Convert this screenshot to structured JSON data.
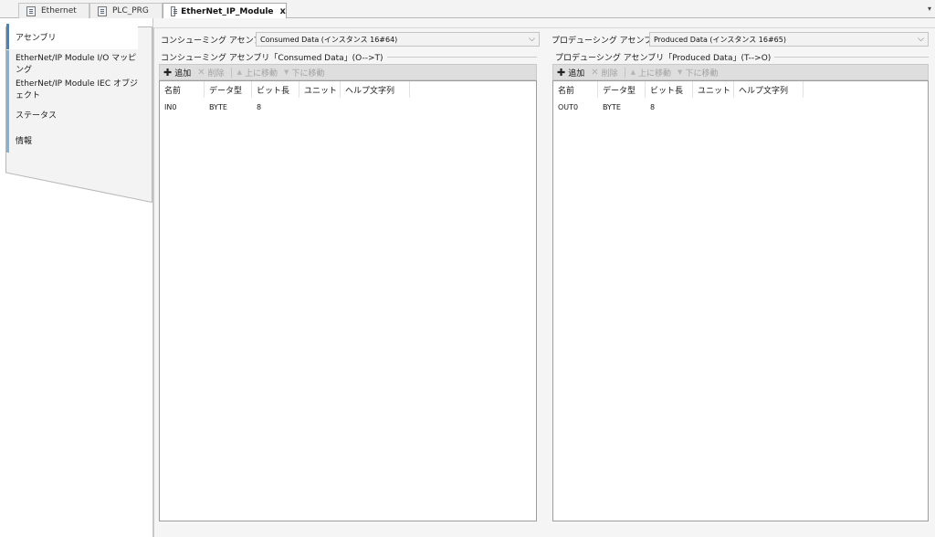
{
  "tabs": [
    {
      "label": "Ethernet"
    },
    {
      "label": "PLC_PRG"
    },
    {
      "label": "EtherNet_IP_Module",
      "close": "x"
    }
  ],
  "tab_overflow": "▾",
  "nav": {
    "items": [
      {
        "label": "アセンブリ"
      },
      {
        "label": "EtherNet/IP Module I/O マッピング"
      },
      {
        "label": "EtherNet/IP Module IEC オブジェクト"
      },
      {
        "label": "ステータス"
      },
      {
        "label": "情報"
      }
    ]
  },
  "consuming": {
    "label": "コンシューミング アセンブリ",
    "select_value": "Consumed Data (インスタンス 16#64)",
    "group_title": "コンシューミング アセンブリ「Consumed Data」(O-->T)",
    "toolbar": {
      "add": "追加",
      "delete": "削除",
      "move_up": "上に移動",
      "move_down": "下に移動"
    },
    "columns": [
      "名前",
      "データ型",
      "ビット長",
      "ユニット",
      "ヘルプ文字列"
    ],
    "rows": [
      [
        "IN0",
        "BYTE",
        "8",
        "",
        ""
      ]
    ]
  },
  "producing": {
    "label": "プロデューシング アセンブリ",
    "select_value": "Produced Data (インスタンス 16#65)",
    "group_title": "プロデューシング アセンブリ「Produced Data」(T-->O)",
    "toolbar": {
      "add": "追加",
      "delete": "削除",
      "move_up": "上に移動",
      "move_down": "下に移動"
    },
    "columns": [
      "名前",
      "データ型",
      "ビット長",
      "ユニット",
      "ヘルプ文字列"
    ],
    "rows": [
      [
        "OUT0",
        "BYTE",
        "8",
        "",
        ""
      ]
    ]
  },
  "colors": {
    "nav_accent": "#3b86d1",
    "toolbar_bg": "#dedede",
    "panel_bg": "#f5f5f5"
  }
}
